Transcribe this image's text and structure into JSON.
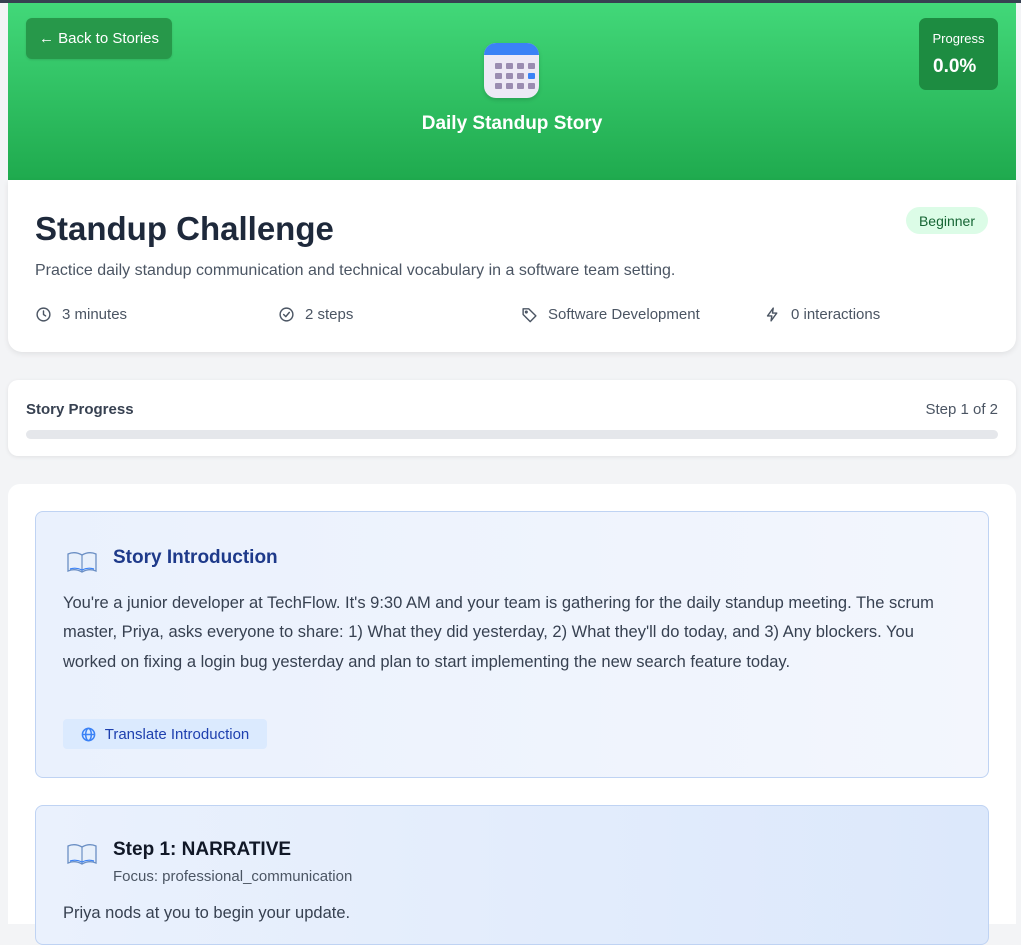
{
  "header": {
    "back_label": "← Back to Stories",
    "story_title": "Daily Standup Story",
    "progress_label": "Progress",
    "progress_value": "0.0%",
    "progress_fraction": 0.0,
    "icon": "calendar-icon"
  },
  "info": {
    "title": "Standup Challenge",
    "level": "Beginner",
    "description": "Practice daily standup communication and technical vocabulary in a software team setting.",
    "duration": "3 minutes",
    "steps": "2 steps",
    "category": "Software Development",
    "interactions": "0 interactions"
  },
  "story_progress": {
    "label": "Story Progress",
    "step_text": "Step 1 of 2",
    "fraction": 0.0
  },
  "intro": {
    "heading": "Story Introduction",
    "text": "You're a junior developer at TechFlow. It's 9:30 AM and your team is gathering for the daily standup meeting. The scrum master, Priya, asks everyone to share: 1) What they did yesterday, 2) What they'll do today, and 3) Any blockers. You worked on fixing a login bug yesterday and plan to start implementing the new search feature today.",
    "translate_label": "Translate Introduction"
  },
  "step": {
    "heading": "Step 1: NARRATIVE",
    "focus": "Focus: professional_communication",
    "text": "Priya nods at you to begin your update."
  },
  "colors": {
    "hero_start": "#42d879",
    "hero_end": "#1faa4e",
    "accent_blue": "#1e3a8a",
    "badge_bg": "#dcfce7"
  }
}
